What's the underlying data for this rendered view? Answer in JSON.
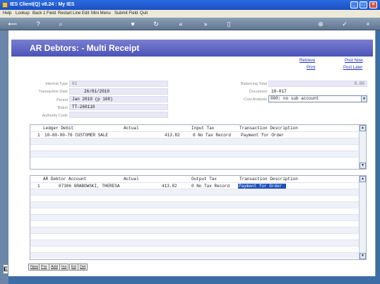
{
  "window": {
    "title": "IES Client(Q) v8.24 : My IES",
    "buttons": {
      "minimize": "_",
      "maximize": "□",
      "close": "×"
    }
  },
  "menu": [
    "Help",
    "Lookup",
    "Back 1 Field",
    "Restart Line Edit",
    "Mini Menu",
    "Submit Field",
    "Quit"
  ],
  "form": {
    "title": "AR Debtors: - Multi Receipt",
    "links": {
      "retrieve": "Retrieve",
      "post_now": "Post Now",
      "print": "Print",
      "post_later": "Post Later"
    },
    "fields": {
      "internal_type_label": "Internal Type",
      "internal_type": "61",
      "transaction_date_label": "Transaction Date",
      "transaction_date": "26/01/2010",
      "period_label": "Period",
      "period": "Jan 2010 (p 108)",
      "batch_label": "Batch",
      "batch": "TT-260110",
      "authority_code_label": "Authority Code",
      "authority_code": "",
      "balancing_total_label": "Balancing Total",
      "balancing_total": "0.00",
      "document_label": "Document",
      "document": "10-017",
      "cost_analysis_label": "Cost Analysis",
      "cost_analysis": "000: no sub account"
    }
  },
  "ledger_grid": {
    "headers": [
      "Ledger Debit",
      "Actual",
      "Input Tax",
      "Transaction Description"
    ],
    "rows": [
      {
        "line": "1",
        "account": "10-00-00-76 CUSTOMER SALE",
        "actual": "413.82",
        "tax": "0 No Tax Record",
        "description": "Payment for Order"
      }
    ]
  },
  "debtor_grid": {
    "headers": [
      "AR Debtor Account",
      "Actual",
      "Output Tax",
      "Transaction Description"
    ],
    "rows": [
      {
        "line": "1",
        "account": "07306 GRABOWSKI, THERESA",
        "actual": "413.82",
        "tax": "0 No Tax Record",
        "description": "Payment for Order"
      }
    ]
  },
  "buttons": [
    "New",
    "Pre",
    "Add",
    "Ins",
    "Ed",
    "Del"
  ],
  "colors": {
    "header": "#4b53b8",
    "titlebar": "#1b4fc2",
    "selection": "#2050b8",
    "link": "#2233aa"
  },
  "icons": [
    "back-arrow-icon",
    "help-icon",
    "search-icon",
    "heart-icon",
    "refresh-icon",
    "rewind-icon",
    "fast-forward-icon",
    "clipboard-icon",
    "add-icon",
    "check-icon",
    "close-icon"
  ]
}
